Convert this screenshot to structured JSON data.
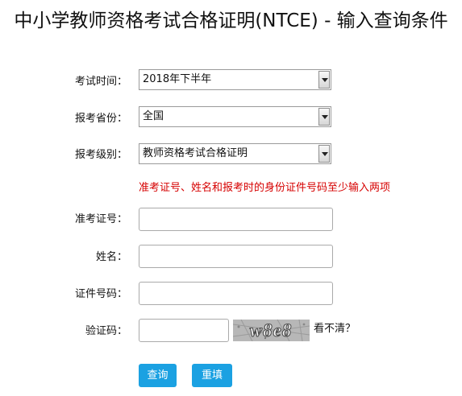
{
  "page_title": "中小学教师资格考试合格证明(NTCE) - 输入查询条件",
  "form": {
    "exam_time": {
      "label": "考试时间：",
      "value": "2018年下半年"
    },
    "province": {
      "label": "报考省份：",
      "value": "全国"
    },
    "level": {
      "label": "报考级别：",
      "value": "教师资格考试合格证明"
    },
    "hint": "准考证号、姓名和报考时的身份证件号码至少输入两项",
    "admission_no": {
      "label": "准考证号：",
      "value": ""
    },
    "name": {
      "label": "姓名：",
      "value": ""
    },
    "id_no": {
      "label": "证件号码：",
      "value": ""
    },
    "captcha": {
      "label": "验证码：",
      "value": "",
      "image_text": "w8e8",
      "refresh_text": "看不清？"
    }
  },
  "buttons": {
    "query": "查询",
    "reset": "重填"
  },
  "colors": {
    "accent": "#1ba1e2",
    "hint": "#d60000"
  }
}
